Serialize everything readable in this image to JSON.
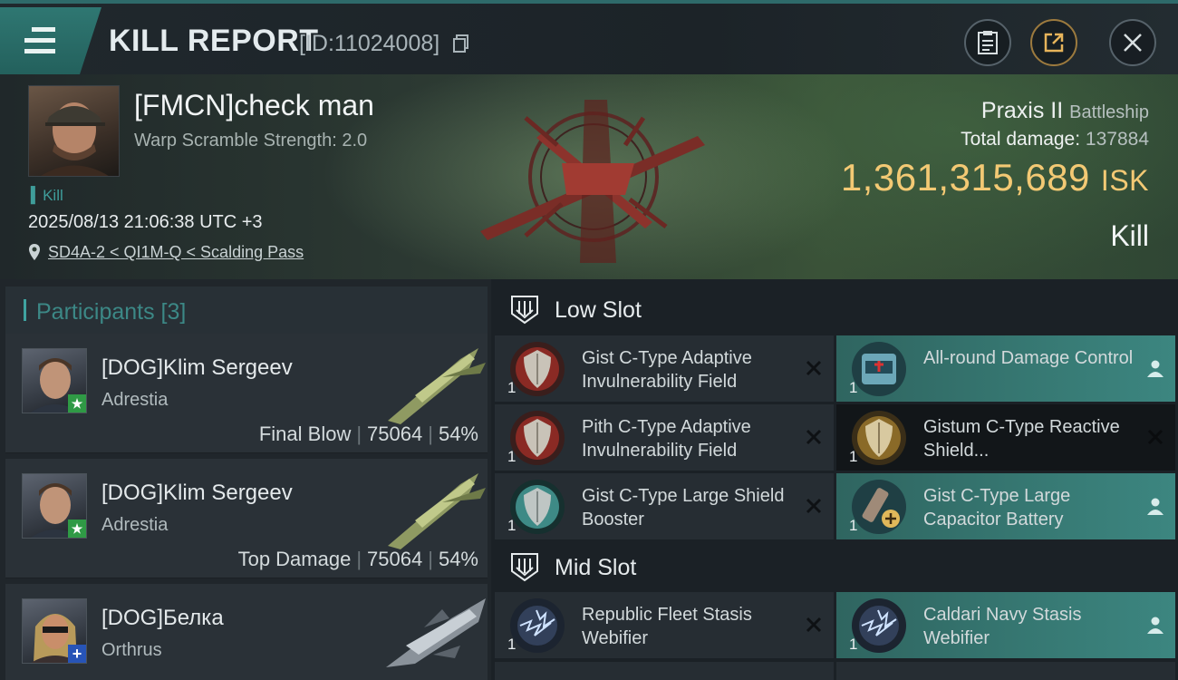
{
  "header": {
    "title": "KILL REPORT",
    "report_id": "[ID:11024008]",
    "menu_icon": "hamburger-menu-icon",
    "actions": [
      "clipboard-icon",
      "share-icon",
      "close-icon"
    ]
  },
  "victim": {
    "pilot": "[FMCN]check man",
    "warp_scramble": "Warp Scramble Strength: 2.0",
    "tag": "Kill",
    "datetime": "2025/08/13 21:06:38 UTC +3",
    "location": "SD4A-2 < QI1M-Q < Scalding Pass",
    "ship": "Praxis II",
    "ship_class": "Battleship",
    "total_damage_label": "Total damage:",
    "total_damage": "137884",
    "isk_value": "1,361,315,689",
    "isk_unit": "ISK",
    "result": "Kill"
  },
  "participants": {
    "label": "Participants [3]",
    "items": [
      {
        "name": "[DOG]Klim Sergeev",
        "ship": "Adrestia",
        "role": "Final Blow",
        "damage": "75064",
        "percent": "54%",
        "badge": "star"
      },
      {
        "name": "[DOG]Klim Sergeev",
        "ship": "Adrestia",
        "role": "Top Damage",
        "damage": "75064",
        "percent": "54%",
        "badge": "star"
      },
      {
        "name": "[DOG]Белка",
        "ship": "Orthrus",
        "role": "",
        "damage": "",
        "percent": "",
        "badge": "plus"
      }
    ]
  },
  "fitting": {
    "low_slot_label": "Low Slot",
    "mid_slot_label": "Mid Slot",
    "low_modules": [
      {
        "qty": "1",
        "name": "Gist C-Type Adaptive Invulnerability Field",
        "status": "destroyed"
      },
      {
        "qty": "1",
        "name": "All-round Damage Control",
        "status": "dropped"
      },
      {
        "qty": "1",
        "name": "Pith C-Type Adaptive Invulnerability Field",
        "status": "destroyed"
      },
      {
        "qty": "1",
        "name": "Gistum C-Type Reactive Shield...",
        "status": "destroyed"
      },
      {
        "qty": "1",
        "name": "Gist C-Type Large Shield Booster",
        "status": "destroyed"
      },
      {
        "qty": "1",
        "name": "Gist C-Type Large Capacitor Battery",
        "status": "dropped"
      }
    ],
    "mid_modules": [
      {
        "qty": "1",
        "name": "Republic Fleet Stasis Webifier",
        "status": "destroyed"
      },
      {
        "qty": "1",
        "name": "Caldari Navy Stasis Webifier",
        "status": "dropped"
      }
    ]
  },
  "colors": {
    "accent_teal": "#3fa3a0",
    "isk_gold": "#f3c974",
    "dropped_bg": "#3c8680"
  }
}
